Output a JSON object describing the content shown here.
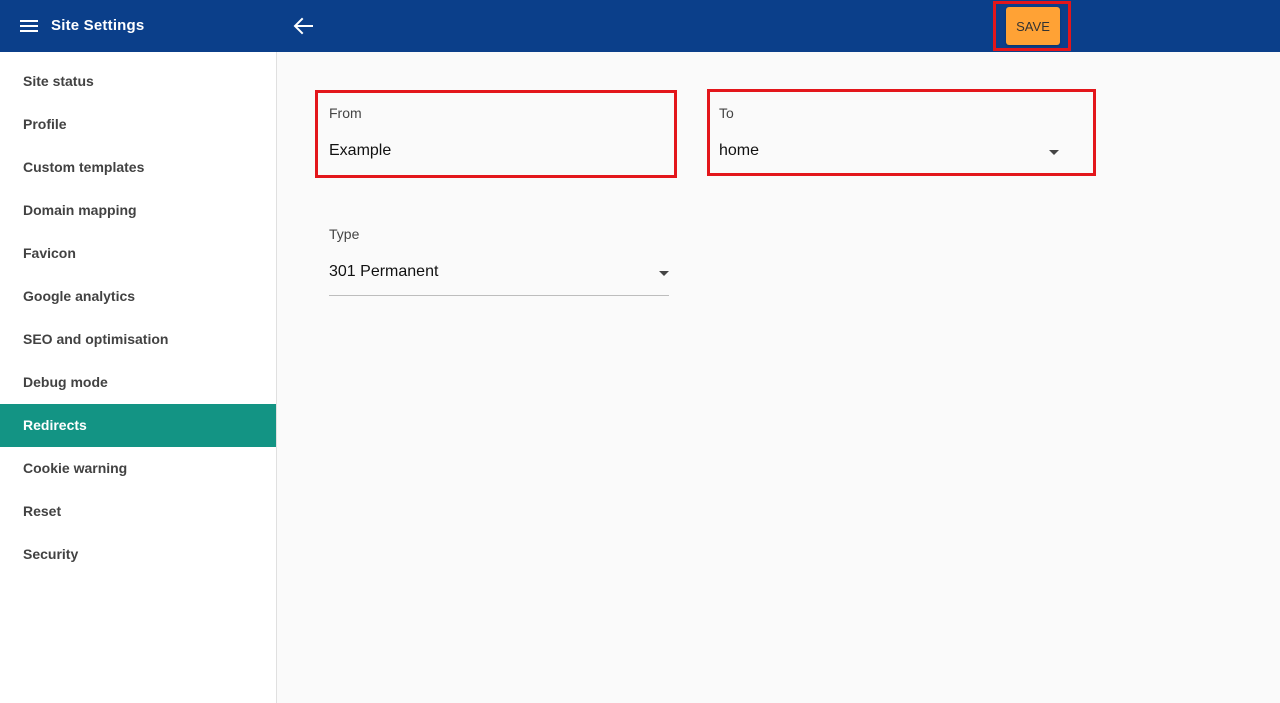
{
  "header": {
    "title": "Site Settings",
    "save_label": "SAVE",
    "bar_color": "#0b3f8a",
    "save_color": "#ffa235"
  },
  "icons": {
    "menu": "hamburger-menu-icon",
    "back": "arrow-left-icon",
    "dropdown": "caret-down-icon"
  },
  "sidebar": {
    "active_color": "#139484",
    "items": [
      {
        "label": "Site status"
      },
      {
        "label": "Profile"
      },
      {
        "label": "Custom templates"
      },
      {
        "label": "Domain mapping"
      },
      {
        "label": "Favicon"
      },
      {
        "label": "Google analytics"
      },
      {
        "label": "SEO and optimisation"
      },
      {
        "label": "Debug mode"
      },
      {
        "label": "Redirects",
        "active": true
      },
      {
        "label": "Cookie warning"
      },
      {
        "label": "Reset"
      },
      {
        "label": "Security"
      }
    ]
  },
  "form": {
    "from": {
      "label": "From",
      "value": "Example"
    },
    "to": {
      "label": "To",
      "value": "home"
    },
    "type": {
      "label": "Type",
      "value": "301 Permanent"
    }
  }
}
